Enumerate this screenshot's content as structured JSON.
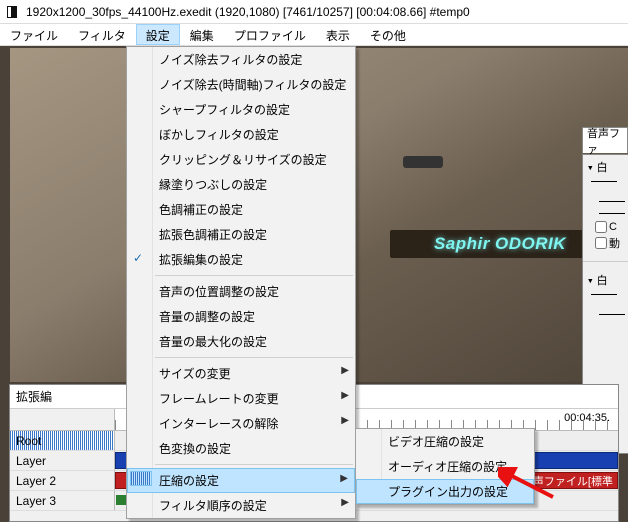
{
  "title": "1920x1200_30fps_44100Hz.exedit  (1920,1080)  [7461/10257]  [00:04:08.66]  #temp0",
  "menubar": {
    "file": "ファイル",
    "filter": "フィルタ",
    "settings": "設定",
    "edit": "編集",
    "profile": "プロファイル",
    "view": "表示",
    "other": "その他"
  },
  "menu": {
    "noise_filter": "ノイズ除去フィルタの設定",
    "noise_time": "ノイズ除去(時間軸)フィルタの設定",
    "sharp": "シャープフィルタの設定",
    "blur": "ぼかしフィルタの設定",
    "clip_resize": "クリッピング＆リサイズの設定",
    "fill": "縁塗りつぶしの設定",
    "color_correct": "色調補正の設定",
    "ext_color": "拡張色調補正の設定",
    "ext_edit": "拡張編集の設定",
    "audio_pos": "音声の位置調整の設定",
    "volume": "音量の調整の設定",
    "max_vol": "音量の最大化の設定",
    "resize": "サイズの変更",
    "framerate": "フレームレートの変更",
    "deinterlace": "インターレースの解除",
    "color_conv": "色変換の設定",
    "compress": "圧縮の設定",
    "filter_order": "フィルタ順序の設定"
  },
  "submenu": {
    "video": "ビデオ圧縮の設定",
    "audio": "オーディオ圧縮の設定",
    "plugin": "プラグイン出力の設定"
  },
  "sign_text": "Saphir ODORIK",
  "right_panel": {
    "title": "音声ファ",
    "tree1": "▾ 白━",
    "opt_c": "C",
    "opt_d": "動",
    "tree2": "▾ 白━"
  },
  "timeline": {
    "title": "拡張編",
    "tc": "00:04:35.",
    "root": "Root",
    "layers": [
      "Layer",
      "Layer 2",
      "Layer 3"
    ],
    "audio_label": "音声ファイル[標準"
  }
}
